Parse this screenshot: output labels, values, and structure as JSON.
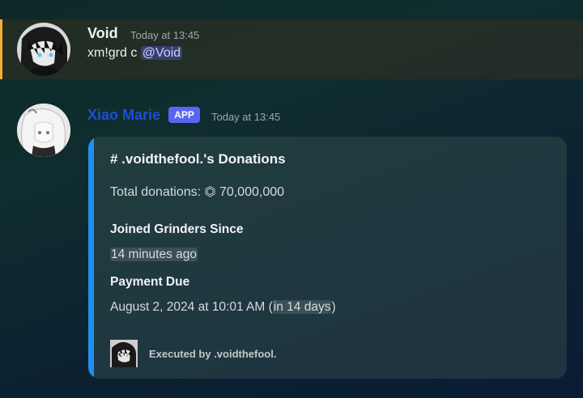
{
  "messages": [
    {
      "author": "Void",
      "timestamp": "Today at 13:45",
      "text": "xm!grd c ",
      "mention": "@Void"
    },
    {
      "author": "Xiao Marie",
      "badge": "APP",
      "timestamp": "Today at 13:45",
      "embed": {
        "title": "# .voidthefool.'s Donations",
        "total": "Total donations: ⏣ 70,000,000",
        "fields": [
          {
            "name": "Joined Grinders Since",
            "value": "14 minutes ago"
          },
          {
            "name": "Payment Due",
            "value_main": "August 2, 2024 at 10:01 AM ",
            "value_paren_open": "(",
            "value_relative": "in 14 days",
            "value_paren_close": ")"
          }
        ],
        "footer": "Executed by .voidthefool."
      }
    }
  ],
  "colors": {
    "highlight_bar": "#f0b132",
    "embed_accent": "#1f8ff0",
    "app_badge": "#5865f2",
    "xiao_name": "#1e4ed8"
  }
}
